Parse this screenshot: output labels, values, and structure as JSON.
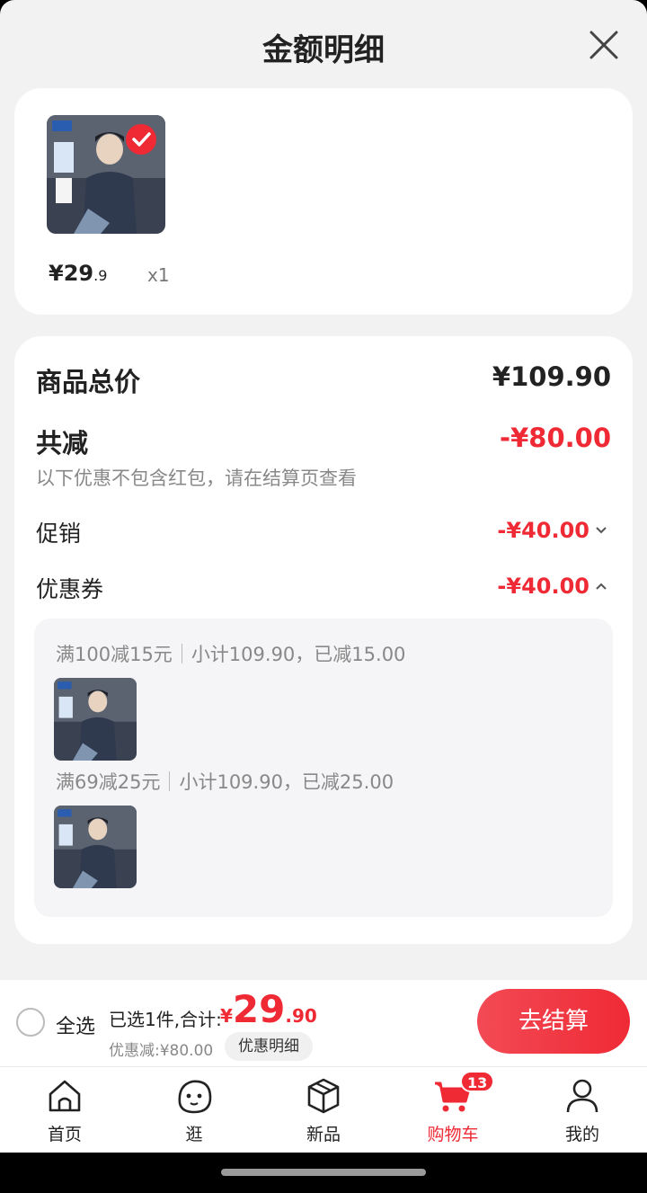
{
  "sheet": {
    "title": "金额明细"
  },
  "product": {
    "price_int": "¥29",
    "price_dec": ".9",
    "qty": "x1"
  },
  "summary": {
    "goods_total_label": "商品总价",
    "goods_total_value": "¥109.90",
    "reduce_label": "共减",
    "reduce_value": "-¥80.00",
    "hint": "以下优惠不包含红包，请在结算页查看",
    "promo_label": "促销",
    "promo_value": "-¥40.00",
    "coupon_label": "优惠券",
    "coupon_value": "-¥40.00"
  },
  "coupons": [
    {
      "rule": "满100减15元",
      "detail": "小计109.90，已减15.00"
    },
    {
      "rule": "满69减25元",
      "detail": "小计109.90，已减25.00"
    }
  ],
  "bottom": {
    "select_all": "全选",
    "selected": "已选1件,合计:",
    "total_cur": "¥",
    "total_int": "29",
    "total_dec": ".90",
    "discount": "优惠减:¥80.00",
    "detail_btn": "优惠明细",
    "checkout": "去结算"
  },
  "tabs": [
    {
      "label": "首页",
      "icon": "home-icon"
    },
    {
      "label": "逛",
      "icon": "browse-face-icon"
    },
    {
      "label": "新品",
      "icon": "package-icon"
    },
    {
      "label": "购物车",
      "icon": "cart-icon",
      "badge": "13",
      "active": true
    },
    {
      "label": "我的",
      "icon": "user-icon"
    }
  ],
  "colors": {
    "accent": "#ef2a35",
    "sheet_bg": "#f2f2f2",
    "coupon_bg": "#f5f5f7"
  }
}
